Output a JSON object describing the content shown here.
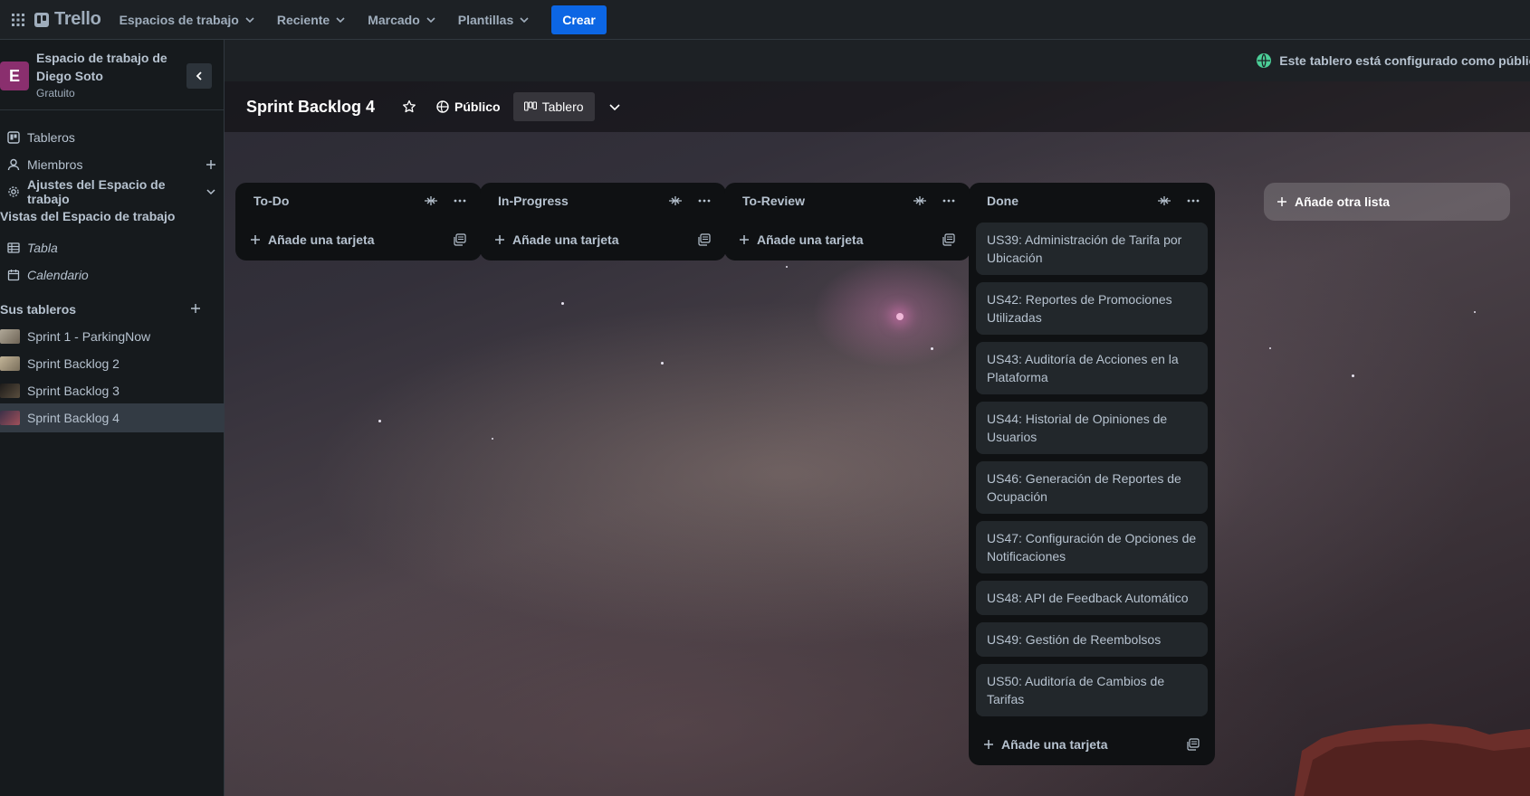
{
  "topbar": {
    "logo_text": "Trello",
    "nav": [
      {
        "label": "Espacios de trabajo"
      },
      {
        "label": "Reciente"
      },
      {
        "label": "Marcado"
      },
      {
        "label": "Plantillas"
      }
    ],
    "create_label": "Crear"
  },
  "sidebar": {
    "workspace_initial": "E",
    "workspace_name": "Espacio de trabajo de Diego Soto",
    "workspace_plan": "Gratuito",
    "items": {
      "boards": "Tableros",
      "members": "Miembros",
      "settings": "Ajustes del Espacio de trabajo"
    },
    "views_title": "Vistas del Espacio de trabajo",
    "views": {
      "table": "Tabla",
      "calendar": "Calendario"
    },
    "boards_title": "Sus tableros",
    "boards": [
      {
        "label": "Sprint 1 - ParkingNow",
        "thumb_color": "#8a8478"
      },
      {
        "label": "Sprint Backlog 2",
        "thumb_color": "#9a8f7a"
      },
      {
        "label": "Sprint Backlog 3",
        "thumb_color": "#3a3530"
      },
      {
        "label": "Sprint Backlog 4",
        "thumb_color": "#6b4a55"
      }
    ]
  },
  "banner": {
    "text": "Este tablero está configurado como público, pero los administradores"
  },
  "board": {
    "title": "Sprint Backlog 4",
    "visibility": "Público",
    "view": "Tablero"
  },
  "lists": [
    {
      "title": "To-Do",
      "cards": [],
      "add_label": "Añade una tarjeta"
    },
    {
      "title": "In-Progress",
      "cards": [],
      "add_label": "Añade una tarjeta"
    },
    {
      "title": "To-Review",
      "cards": [],
      "add_label": "Añade una tarjeta"
    },
    {
      "title": "Done",
      "add_label": "Añade una tarjeta",
      "cards": [
        "US39: Administración de Tarifa por Ubicación",
        "US42: Reportes de Promociones Utilizadas",
        "US43: Auditoría de Acciones en la Plataforma",
        "US44: Historial de Opiniones de Usuarios",
        "US46: Generación de Reportes de Ocupación",
        "US47: Configuración de Opciones de Notificaciones",
        "US48: API de Feedback Automático",
        "US49: Gestión de Reembolsos",
        "US50: Auditoría de Cambios de Tarifas"
      ]
    }
  ],
  "add_list_label": "Añade otra lista",
  "colors": {
    "accent": "#0c66e4",
    "workspace_avatar": "#8a2f6e",
    "public_icon": "#4bce97"
  }
}
